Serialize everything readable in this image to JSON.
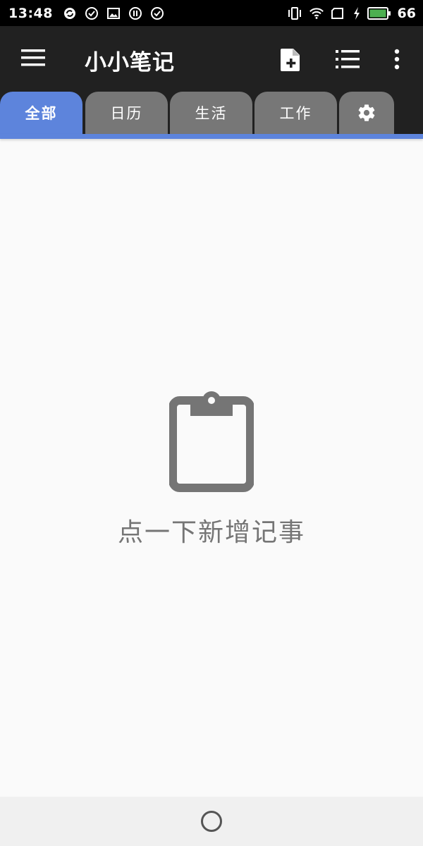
{
  "status_bar": {
    "time": "13:48",
    "battery": "66",
    "left_icons": [
      "sync-icon",
      "check-circle-icon",
      "image-icon",
      "pause-circle-icon",
      "check-circle-icon"
    ],
    "right_icons": [
      "vibrate-icon",
      "wifi-icon",
      "sim-icon",
      "charging-icon",
      "battery-icon"
    ],
    "battery_color": "#4caf50"
  },
  "app_bar": {
    "title": "小小笔记",
    "background": "#212121",
    "actions": [
      "add-note-icon",
      "list-icon",
      "more-vert-icon"
    ]
  },
  "tabs": [
    {
      "label": "全部",
      "active": true
    },
    {
      "label": "日历",
      "active": false
    },
    {
      "label": "生活",
      "active": false
    },
    {
      "label": "工作",
      "active": false
    }
  ],
  "settings_tab_icon": "gear-icon",
  "accent_color": "#5d84dc",
  "empty_state": {
    "icon": "clipboard-icon",
    "text": "点一下新增记事"
  },
  "nav_bar": {
    "home_icon": "home-circle-icon"
  }
}
